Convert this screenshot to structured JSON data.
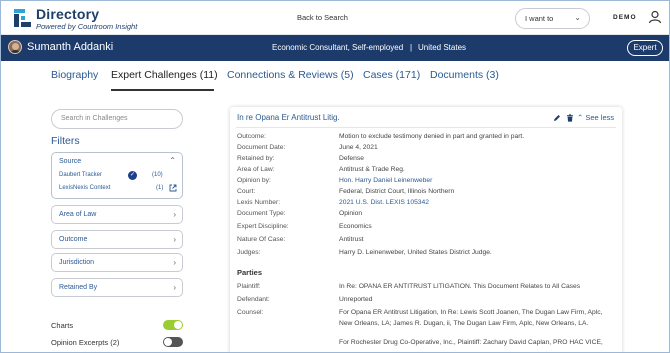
{
  "header": {
    "brand_title": "Directory",
    "brand_subtitle": "Powered by Courtroom Insight",
    "back_link": "Back to Search",
    "want_placeholder": "I want to",
    "demo_label": "DEMO",
    "logo_icon": "courtroom-insight-logo",
    "user_icon": "user-icon"
  },
  "profile": {
    "name": "Sumanth Addanki",
    "role": "Economic Consultant, Self-employed",
    "separator": "|",
    "location": "United States",
    "expert_button": "Expert"
  },
  "tabs": [
    {
      "label": "Biography",
      "active": false
    },
    {
      "label": "Expert Challenges (11)",
      "active": true
    },
    {
      "label": "Connections & Reviews (5)",
      "active": false
    },
    {
      "label": "Cases (171)",
      "active": false
    },
    {
      "label": "Documents (3)",
      "active": false
    }
  ],
  "filters": {
    "search_placeholder": "Search in Challenges",
    "title": "Filters",
    "source": {
      "label": "Source",
      "items": [
        {
          "label": "Daubert Tracker",
          "count": "(10)",
          "checked": true
        },
        {
          "label": "LexisNexis Context",
          "count": "(1)",
          "external": true
        }
      ]
    },
    "groups": [
      {
        "label": "Area of Law"
      },
      {
        "label": "Outcome"
      },
      {
        "label": "Jurisdiction"
      },
      {
        "label": "Retained By"
      }
    ],
    "toggles": [
      {
        "label": "Charts",
        "on": true
      },
      {
        "label": "Opinion Excerpts (2)",
        "on": false
      }
    ]
  },
  "case": {
    "title": "In re Opana Er Antitrust Litig.",
    "see_less": "See less",
    "fields": [
      {
        "label": "Outcome:",
        "value": "Motion to exclude testimony denied in part and granted in part."
      },
      {
        "label": "Document Date:",
        "value": "June 4, 2021"
      },
      {
        "label": "Retained by:",
        "value": "Defense"
      },
      {
        "label": "Area of Law:",
        "value": "Antitrust & Trade Reg."
      },
      {
        "label": "Opinion by:",
        "value": "Hon. Harry Daniel Leinenweber",
        "link": true
      },
      {
        "label": "Court:",
        "value": "Federal, District Court, Illinois Northern"
      },
      {
        "label": "Lexis Number:",
        "value": "2021 U.S. Dist. LEXIS 105342",
        "link": true
      },
      {
        "label": "Document Type:",
        "value": "Opinion"
      },
      {
        "label": "Expert Discipline:",
        "value": "Economics"
      },
      {
        "label": "Nature Of Case:",
        "value": "Antitrust"
      },
      {
        "label": "Judges:",
        "value": "Harry D. Leinenweber, United States District Judge."
      }
    ],
    "parties_title": "Parties",
    "parties": [
      {
        "label": "Plaintiff:",
        "value": "In Re: OPANA ER ANTITRUST LITIGATION. This Document Relates to All Cases"
      },
      {
        "label": "Defendant:",
        "value": "Unreported"
      },
      {
        "label": "Counsel:",
        "lines": [
          "For Opana ER Antitrust Litigation, In Re: Lewis Scott Joanen, The Dugan Law Firm, Aplc,",
          "New Orleans, LA; James R. Dugan, ii, The Dugan Law Firm, Aplc, New Orleans, LA.",
          "For Rochester Drug Co-Operative, Inc., Plaintiff: Zachary David Caplan, PRO HAC VICE,"
        ]
      }
    ]
  },
  "colors": {
    "navy": "#1c3a6a",
    "link": "#2b5a93",
    "toggle_on": "#9acd32",
    "toggle_off": "#555555"
  }
}
